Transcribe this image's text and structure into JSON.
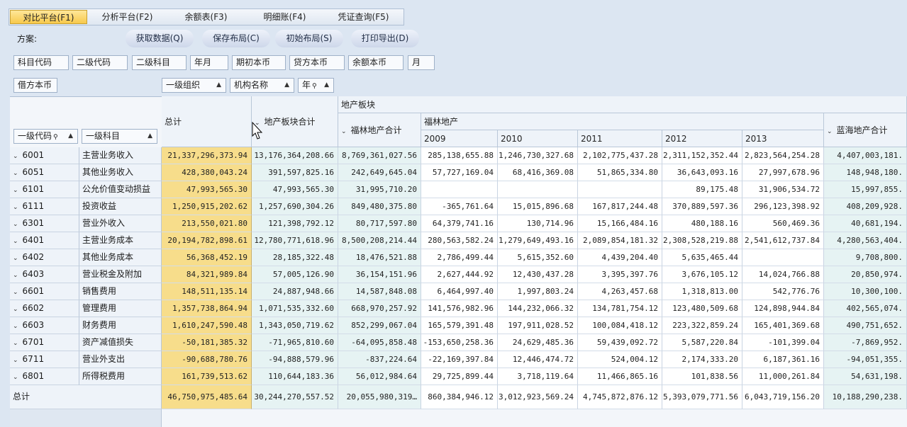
{
  "tabs": [
    {
      "label": "对比平台(F1)",
      "active": true
    },
    {
      "label": "分析平台(F2)",
      "active": false
    },
    {
      "label": "余额表(F3)",
      "active": false
    },
    {
      "label": "明细账(F4)",
      "active": false
    },
    {
      "label": "凭证查询(F5)",
      "active": false
    }
  ],
  "toolbar": {
    "scheme_label": "方案:",
    "buttons": [
      "获取数据(Q)",
      "保存布局(C)",
      "初始布局(S)",
      "打印导出(D)"
    ]
  },
  "available_fields": [
    "科目代码",
    "二级代码",
    "二级科目",
    "年月",
    "期初本币",
    "贷方本币",
    "余额本币",
    "月"
  ],
  "data_field": "借方本币",
  "column_fields": [
    "一级组织",
    "机构名称",
    "年"
  ],
  "row_fields": [
    "一级代码",
    "一级科目"
  ],
  "header": {
    "grand_total": "总计",
    "l1_subtotal": "地产板块合计",
    "l1_group": "地产板块",
    "l2_subtotal": "福林地产合计",
    "l2_group": "福林地产",
    "years": [
      "2009",
      "2010",
      "2011",
      "2012",
      "2013"
    ],
    "l2_next_subtotal": "蓝海地产合计"
  },
  "rows": [
    {
      "code": "6001",
      "name": "主营业务收入",
      "values": [
        "21,337,296,373.94",
        "13,176,364,208.66",
        "8,769,361,027.56",
        "285,138,655.88",
        "1,246,730,327.68",
        "2,102,775,437.28",
        "2,311,152,352.44",
        "2,823,564,254.28",
        "4,407,003,181."
      ]
    },
    {
      "code": "6051",
      "name": "其他业务收入",
      "values": [
        "428,380,043.24",
        "391,597,825.16",
        "242,649,645.04",
        "57,727,169.04",
        "68,416,369.08",
        "51,865,334.80",
        "36,643,093.16",
        "27,997,678.96",
        "148,948,180."
      ]
    },
    {
      "code": "6101",
      "name": "公允价值变动损益",
      "values": [
        "47,993,565.30",
        "47,993,565.30",
        "31,995,710.20",
        "",
        "",
        "",
        "89,175.48",
        "31,906,534.72",
        "15,997,855."
      ]
    },
    {
      "code": "6111",
      "name": "投资收益",
      "values": [
        "1,250,915,202.62",
        "1,257,690,304.26",
        "849,480,375.80",
        "-365,761.64",
        "15,015,896.68",
        "167,817,244.48",
        "370,889,597.36",
        "296,123,398.92",
        "408,209,928."
      ]
    },
    {
      "code": "6301",
      "name": "营业外收入",
      "values": [
        "213,550,021.80",
        "121,398,792.12",
        "80,717,597.80",
        "64,379,741.16",
        "130,714.96",
        "15,166,484.16",
        "480,188.16",
        "560,469.36",
        "40,681,194."
      ]
    },
    {
      "code": "6401",
      "name": "主营业务成本",
      "values": [
        "20,194,782,898.61",
        "12,780,771,618.96",
        "8,500,208,214.44",
        "280,563,582.24",
        "1,279,649,493.16",
        "2,089,854,181.32",
        "2,308,528,219.88",
        "2,541,612,737.84",
        "4,280,563,404."
      ]
    },
    {
      "code": "6402",
      "name": "其他业务成本",
      "values": [
        "56,368,452.19",
        "28,185,322.48",
        "18,476,521.88",
        "2,786,499.44",
        "5,615,352.60",
        "4,439,204.40",
        "5,635,465.44",
        "",
        "9,708,800."
      ]
    },
    {
      "code": "6403",
      "name": "营业税金及附加",
      "values": [
        "84,321,989.84",
        "57,005,126.90",
        "36,154,151.96",
        "2,627,444.92",
        "12,430,437.28",
        "3,395,397.76",
        "3,676,105.12",
        "14,024,766.88",
        "20,850,974."
      ]
    },
    {
      "code": "6601",
      "name": "销售费用",
      "values": [
        "148,511,135.14",
        "24,887,948.66",
        "14,587,848.08",
        "6,464,997.40",
        "1,997,803.24",
        "4,263,457.68",
        "1,318,813.00",
        "542,776.76",
        "10,300,100."
      ]
    },
    {
      "code": "6602",
      "name": "管理费用",
      "values": [
        "1,357,738,864.94",
        "1,071,535,332.60",
        "668,970,257.92",
        "141,576,982.96",
        "144,232,066.32",
        "134,781,754.12",
        "123,480,509.68",
        "124,898,944.84",
        "402,565,074."
      ]
    },
    {
      "code": "6603",
      "name": "财务费用",
      "values": [
        "1,610,247,590.48",
        "1,343,050,719.62",
        "852,299,067.04",
        "165,579,391.48",
        "197,911,028.52",
        "100,084,418.12",
        "223,322,859.24",
        "165,401,369.68",
        "490,751,652."
      ]
    },
    {
      "code": "6701",
      "name": "资产减值损失",
      "values": [
        "-50,181,385.32",
        "-71,965,810.60",
        "-64,095,858.48",
        "-153,650,258.36",
        "24,629,485.36",
        "59,439,092.72",
        "5,587,220.84",
        "-101,399.04",
        "-7,869,952."
      ]
    },
    {
      "code": "6711",
      "name": "营业外支出",
      "values": [
        "-90,688,780.76",
        "-94,888,579.96",
        "-837,224.64",
        "-22,169,397.84",
        "12,446,474.72",
        "524,004.12",
        "2,174,333.20",
        "6,187,361.16",
        "-94,051,355."
      ]
    },
    {
      "code": "6801",
      "name": "所得税费用",
      "values": [
        "161,739,513.62",
        "110,644,183.36",
        "56,012,984.64",
        "29,725,899.44",
        "3,718,119.64",
        "11,466,865.16",
        "101,838.56",
        "11,000,261.84",
        "54,631,198."
      ]
    }
  ],
  "footer": {
    "label": "总计",
    "values": [
      "46,750,975,485.64",
      "30,244,270,557.52",
      "20,055,980,319…",
      "860,384,946.12",
      "3,012,923,569.24",
      "4,745,872,876.12",
      "5,393,079,771.56",
      "6,043,719,156.20",
      "10,188,290,238."
    ]
  }
}
